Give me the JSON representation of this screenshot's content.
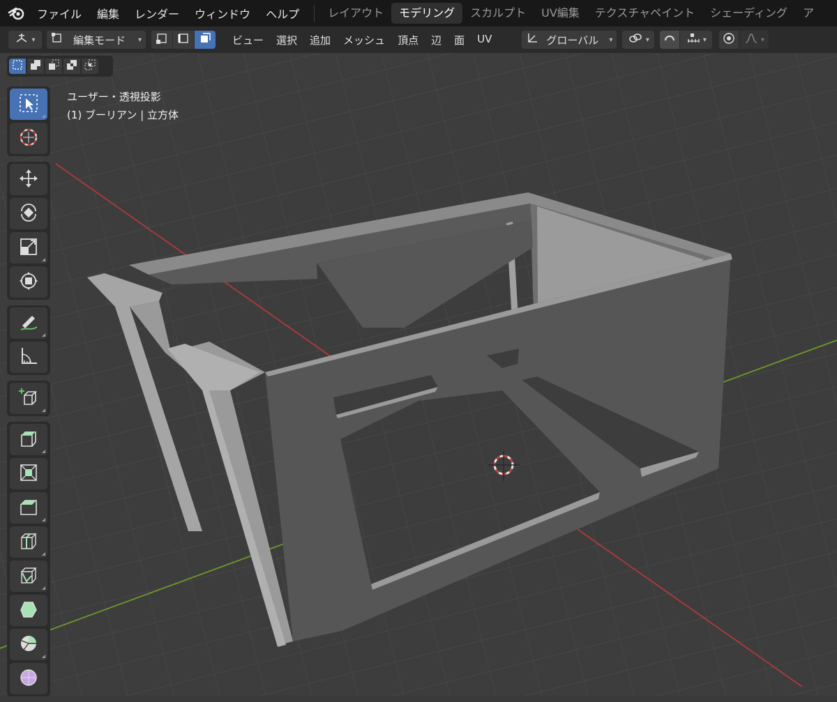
{
  "topbar": {
    "logo_icon": "blender-logo-icon",
    "menus": [
      "ファイル",
      "編集",
      "レンダー",
      "ウィンドウ",
      "ヘルプ"
    ],
    "workspace_tabs": [
      "レイアウト",
      "モデリング",
      "スカルプト",
      "UV編集",
      "テクスチャペイント",
      "シェーディング",
      "ア"
    ],
    "active_tab": "モデリング"
  },
  "header": {
    "editor_type_icon": "3d-viewport-icon",
    "mode_label": "編集モード",
    "select_mode_buttons": [
      "vertex-select",
      "edge-select",
      "face-select"
    ],
    "active_select_mode": "face-select",
    "menus": [
      "ビュー",
      "選択",
      "追加",
      "メッシュ",
      "頂点",
      "辺",
      "面",
      "UV"
    ],
    "transform_orientation": "グローバル",
    "pivot_icon": "pivot-link-icon",
    "snap_icon": "snap-magnet-icon",
    "snap_increment_icon": "snap-increment-icon",
    "proportional_icon": "proportional-edit-icon",
    "falloff_icon": "falloff-curve-icon"
  },
  "select_box_modes": [
    "set",
    "extend",
    "subtract",
    "difference",
    "intersect"
  ],
  "viewport": {
    "view_name": "ユーザー・透視投影",
    "object_info": "(1) ブーリアン | 立方体",
    "background": "#3d3d3d",
    "grid_color": "#4b4b4b",
    "x_axis_color": "#b23a3a",
    "y_axis_color": "#6e9a2a"
  },
  "toolbar": {
    "groups": [
      [
        "select-box-icon",
        "cursor-icon"
      ],
      [
        "move-icon",
        "rotate-icon",
        "scale-icon",
        "transform-icon"
      ],
      [
        "annotate-icon",
        "measure-icon"
      ],
      [
        "add-cube-icon"
      ],
      [
        "extrude-icon",
        "inset-icon",
        "bevel-icon",
        "loop-cut-icon",
        "knife-icon",
        "poly-build-icon",
        "spin-icon",
        "smooth-icon"
      ]
    ],
    "active_tool": "select-box-icon"
  },
  "colors": {
    "accent": "#4772b3",
    "topbar_bg": "#181818",
    "header_bg": "#2b2b2b",
    "button_bg": "#3b3b3b"
  }
}
